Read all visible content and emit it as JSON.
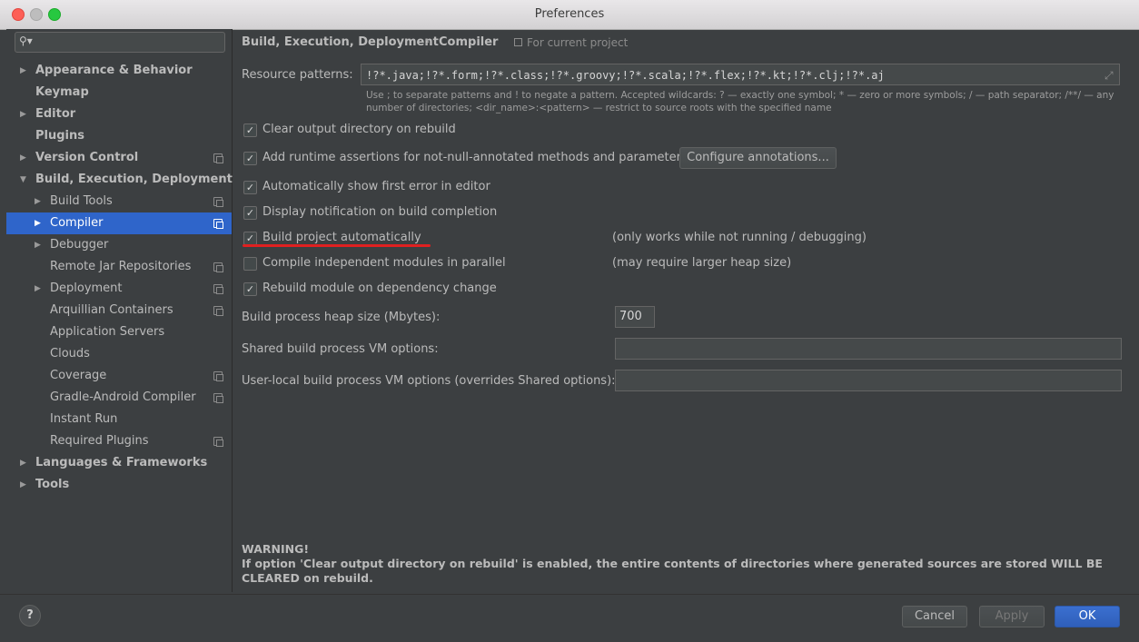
{
  "window": {
    "title": "Preferences"
  },
  "search": {
    "placeholder": ""
  },
  "sidebar": {
    "items": [
      {
        "label": "Appearance & Behavior",
        "level": 0,
        "bold": true,
        "arrow": "right",
        "proj": false,
        "selected": false
      },
      {
        "label": "Keymap",
        "level": 0,
        "bold": true,
        "arrow": "",
        "proj": false,
        "selected": false
      },
      {
        "label": "Editor",
        "level": 0,
        "bold": true,
        "arrow": "right",
        "proj": false,
        "selected": false
      },
      {
        "label": "Plugins",
        "level": 0,
        "bold": true,
        "arrow": "",
        "proj": false,
        "selected": false
      },
      {
        "label": "Version Control",
        "level": 0,
        "bold": true,
        "arrow": "right",
        "proj": true,
        "selected": false
      },
      {
        "label": "Build, Execution, Deployment",
        "level": 0,
        "bold": true,
        "arrow": "down",
        "proj": false,
        "selected": false
      },
      {
        "label": "Build Tools",
        "level": 1,
        "bold": false,
        "arrow": "right",
        "proj": true,
        "selected": false
      },
      {
        "label": "Compiler",
        "level": 1,
        "bold": false,
        "arrow": "right",
        "proj": true,
        "selected": true
      },
      {
        "label": "Debugger",
        "level": 1,
        "bold": false,
        "arrow": "right",
        "proj": false,
        "selected": false
      },
      {
        "label": "Remote Jar Repositories",
        "level": 1,
        "bold": false,
        "arrow": "",
        "proj": true,
        "selected": false
      },
      {
        "label": "Deployment",
        "level": 1,
        "bold": false,
        "arrow": "right",
        "proj": true,
        "selected": false
      },
      {
        "label": "Arquillian Containers",
        "level": 1,
        "bold": false,
        "arrow": "",
        "proj": true,
        "selected": false
      },
      {
        "label": "Application Servers",
        "level": 1,
        "bold": false,
        "arrow": "",
        "proj": false,
        "selected": false
      },
      {
        "label": "Clouds",
        "level": 1,
        "bold": false,
        "arrow": "",
        "proj": false,
        "selected": false
      },
      {
        "label": "Coverage",
        "level": 1,
        "bold": false,
        "arrow": "",
        "proj": true,
        "selected": false
      },
      {
        "label": "Gradle-Android Compiler",
        "level": 1,
        "bold": false,
        "arrow": "",
        "proj": true,
        "selected": false
      },
      {
        "label": "Instant Run",
        "level": 1,
        "bold": false,
        "arrow": "",
        "proj": false,
        "selected": false
      },
      {
        "label": "Required Plugins",
        "level": 1,
        "bold": false,
        "arrow": "",
        "proj": true,
        "selected": false
      },
      {
        "label": "Languages & Frameworks",
        "level": 0,
        "bold": true,
        "arrow": "right",
        "proj": false,
        "selected": false
      },
      {
        "label": "Tools",
        "level": 0,
        "bold": true,
        "arrow": "right",
        "proj": false,
        "selected": false
      }
    ]
  },
  "breadcrumb": {
    "section": "Build, Execution, Deployment",
    "separator": "›",
    "page": "Compiler",
    "scope": "For current project"
  },
  "resource": {
    "label": "Resource patterns:",
    "value": "!?*.java;!?*.form;!?*.class;!?*.groovy;!?*.scala;!?*.flex;!?*.kt;!?*.clj;!?*.aj",
    "hint": "Use ; to separate patterns and ! to negate a pattern. Accepted wildcards: ? — exactly one symbol; * — zero or more symbols; / — path separator; /**/ — any number of directories; <dir_name>:<pattern> — restrict to source roots with the specified name"
  },
  "options": [
    {
      "label": "Clear output directory on rebuild",
      "checked": true,
      "note": ""
    },
    {
      "label": "Add runtime assertions for not-null-annotated methods and parameters",
      "checked": true,
      "note": ""
    },
    {
      "label": "Automatically show first error in editor",
      "checked": true,
      "note": ""
    },
    {
      "label": "Display notification on build completion",
      "checked": true,
      "note": ""
    },
    {
      "label": "Build project automatically",
      "checked": true,
      "note": "(only works while not running / debugging)"
    },
    {
      "label": "Compile independent modules in parallel",
      "checked": false,
      "note": "(may require larger heap size)"
    },
    {
      "label": "Rebuild module on dependency change",
      "checked": true,
      "note": ""
    }
  ],
  "configure_button": "Configure annotations...",
  "heap": {
    "label": "Build process heap size (Mbytes):",
    "value": "700"
  },
  "shared_vm": {
    "label": "Shared build process VM options:",
    "value": ""
  },
  "user_vm": {
    "label": "User-local build process VM options (overrides Shared options):",
    "value": ""
  },
  "warning": {
    "title": "WARNING!",
    "text": "If option 'Clear output directory on rebuild' is enabled, the entire contents of directories where generated sources are stored WILL BE CLEARED on rebuild."
  },
  "buttons": {
    "help": "?",
    "cancel": "Cancel",
    "apply": "Apply",
    "ok": "OK"
  },
  "icons": {
    "search": "search-icon",
    "expand": "expand-icon",
    "checkmark": "✓"
  },
  "colors": {
    "accent": "#2f65ca",
    "highlight_underline": "#e02020"
  }
}
